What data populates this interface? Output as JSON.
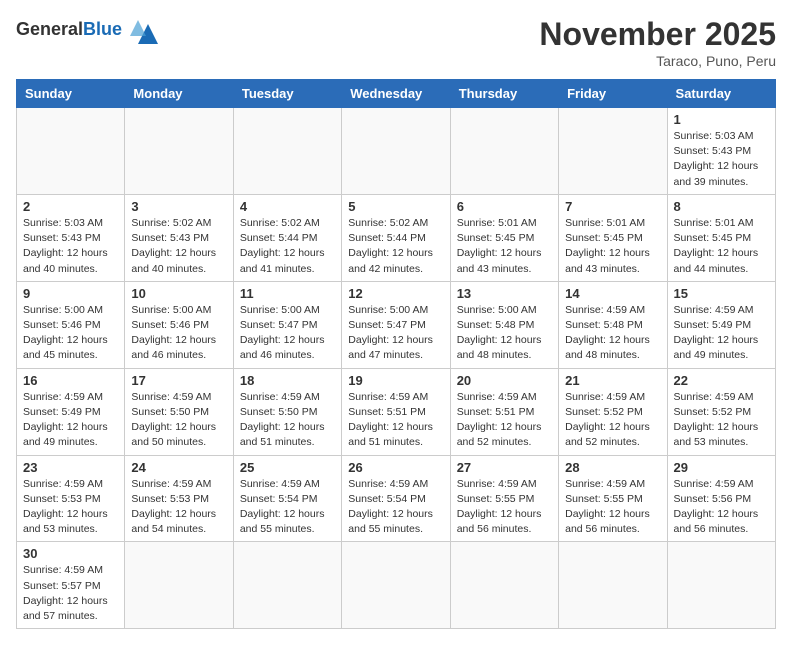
{
  "logo": {
    "general": "General",
    "blue": "Blue"
  },
  "title": "November 2025",
  "subtitle": "Taraco, Puno, Peru",
  "days_of_week": [
    "Sunday",
    "Monday",
    "Tuesday",
    "Wednesday",
    "Thursday",
    "Friday",
    "Saturday"
  ],
  "weeks": [
    [
      {
        "day": "",
        "info": ""
      },
      {
        "day": "",
        "info": ""
      },
      {
        "day": "",
        "info": ""
      },
      {
        "day": "",
        "info": ""
      },
      {
        "day": "",
        "info": ""
      },
      {
        "day": "",
        "info": ""
      },
      {
        "day": "1",
        "info": "Sunrise: 5:03 AM\nSunset: 5:43 PM\nDaylight: 12 hours\nand 39 minutes."
      }
    ],
    [
      {
        "day": "2",
        "info": "Sunrise: 5:03 AM\nSunset: 5:43 PM\nDaylight: 12 hours\nand 40 minutes."
      },
      {
        "day": "3",
        "info": "Sunrise: 5:02 AM\nSunset: 5:43 PM\nDaylight: 12 hours\nand 40 minutes."
      },
      {
        "day": "4",
        "info": "Sunrise: 5:02 AM\nSunset: 5:44 PM\nDaylight: 12 hours\nand 41 minutes."
      },
      {
        "day": "5",
        "info": "Sunrise: 5:02 AM\nSunset: 5:44 PM\nDaylight: 12 hours\nand 42 minutes."
      },
      {
        "day": "6",
        "info": "Sunrise: 5:01 AM\nSunset: 5:45 PM\nDaylight: 12 hours\nand 43 minutes."
      },
      {
        "day": "7",
        "info": "Sunrise: 5:01 AM\nSunset: 5:45 PM\nDaylight: 12 hours\nand 43 minutes."
      },
      {
        "day": "8",
        "info": "Sunrise: 5:01 AM\nSunset: 5:45 PM\nDaylight: 12 hours\nand 44 minutes."
      }
    ],
    [
      {
        "day": "9",
        "info": "Sunrise: 5:00 AM\nSunset: 5:46 PM\nDaylight: 12 hours\nand 45 minutes."
      },
      {
        "day": "10",
        "info": "Sunrise: 5:00 AM\nSunset: 5:46 PM\nDaylight: 12 hours\nand 46 minutes."
      },
      {
        "day": "11",
        "info": "Sunrise: 5:00 AM\nSunset: 5:47 PM\nDaylight: 12 hours\nand 46 minutes."
      },
      {
        "day": "12",
        "info": "Sunrise: 5:00 AM\nSunset: 5:47 PM\nDaylight: 12 hours\nand 47 minutes."
      },
      {
        "day": "13",
        "info": "Sunrise: 5:00 AM\nSunset: 5:48 PM\nDaylight: 12 hours\nand 48 minutes."
      },
      {
        "day": "14",
        "info": "Sunrise: 4:59 AM\nSunset: 5:48 PM\nDaylight: 12 hours\nand 48 minutes."
      },
      {
        "day": "15",
        "info": "Sunrise: 4:59 AM\nSunset: 5:49 PM\nDaylight: 12 hours\nand 49 minutes."
      }
    ],
    [
      {
        "day": "16",
        "info": "Sunrise: 4:59 AM\nSunset: 5:49 PM\nDaylight: 12 hours\nand 49 minutes."
      },
      {
        "day": "17",
        "info": "Sunrise: 4:59 AM\nSunset: 5:50 PM\nDaylight: 12 hours\nand 50 minutes."
      },
      {
        "day": "18",
        "info": "Sunrise: 4:59 AM\nSunset: 5:50 PM\nDaylight: 12 hours\nand 51 minutes."
      },
      {
        "day": "19",
        "info": "Sunrise: 4:59 AM\nSunset: 5:51 PM\nDaylight: 12 hours\nand 51 minutes."
      },
      {
        "day": "20",
        "info": "Sunrise: 4:59 AM\nSunset: 5:51 PM\nDaylight: 12 hours\nand 52 minutes."
      },
      {
        "day": "21",
        "info": "Sunrise: 4:59 AM\nSunset: 5:52 PM\nDaylight: 12 hours\nand 52 minutes."
      },
      {
        "day": "22",
        "info": "Sunrise: 4:59 AM\nSunset: 5:52 PM\nDaylight: 12 hours\nand 53 minutes."
      }
    ],
    [
      {
        "day": "23",
        "info": "Sunrise: 4:59 AM\nSunset: 5:53 PM\nDaylight: 12 hours\nand 53 minutes."
      },
      {
        "day": "24",
        "info": "Sunrise: 4:59 AM\nSunset: 5:53 PM\nDaylight: 12 hours\nand 54 minutes."
      },
      {
        "day": "25",
        "info": "Sunrise: 4:59 AM\nSunset: 5:54 PM\nDaylight: 12 hours\nand 55 minutes."
      },
      {
        "day": "26",
        "info": "Sunrise: 4:59 AM\nSunset: 5:54 PM\nDaylight: 12 hours\nand 55 minutes."
      },
      {
        "day": "27",
        "info": "Sunrise: 4:59 AM\nSunset: 5:55 PM\nDaylight: 12 hours\nand 56 minutes."
      },
      {
        "day": "28",
        "info": "Sunrise: 4:59 AM\nSunset: 5:55 PM\nDaylight: 12 hours\nand 56 minutes."
      },
      {
        "day": "29",
        "info": "Sunrise: 4:59 AM\nSunset: 5:56 PM\nDaylight: 12 hours\nand 56 minutes."
      }
    ],
    [
      {
        "day": "30",
        "info": "Sunrise: 4:59 AM\nSunset: 5:57 PM\nDaylight: 12 hours\nand 57 minutes."
      },
      {
        "day": "",
        "info": ""
      },
      {
        "day": "",
        "info": ""
      },
      {
        "day": "",
        "info": ""
      },
      {
        "day": "",
        "info": ""
      },
      {
        "day": "",
        "info": ""
      },
      {
        "day": "",
        "info": ""
      }
    ]
  ]
}
